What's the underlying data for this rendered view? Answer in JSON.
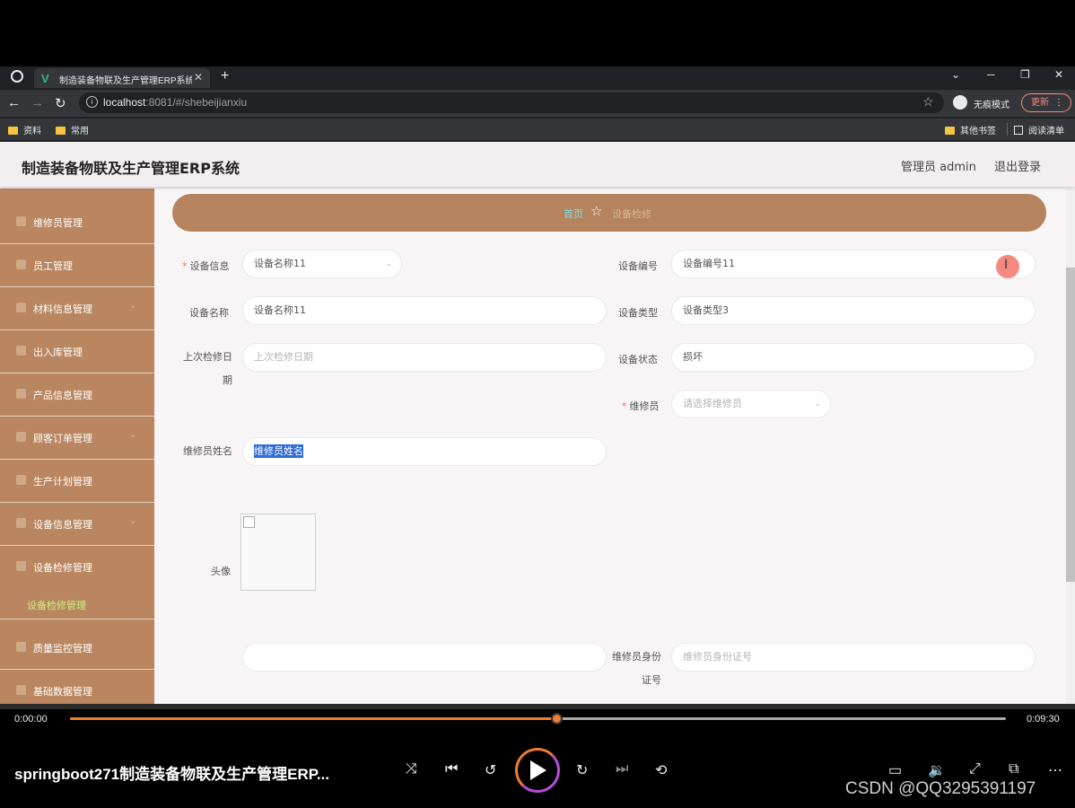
{
  "browser": {
    "tab_title": "制造装备物联及生产管理ERP系统",
    "url_host": "localhost",
    "url_path": ":8081/#/shebeijianxiu",
    "incognito_label": "无痕模式",
    "update_label": "更新",
    "bookmarks": [
      "资料",
      "常用"
    ],
    "bookmarks_right": [
      "其他书签",
      "阅读清单"
    ]
  },
  "app": {
    "title": "制造装备物联及生产管理ERP系统",
    "admin_label": "管理员 admin",
    "logout_label": "退出登录"
  },
  "sidebar": {
    "items": [
      {
        "label": "维修员管理",
        "icon": "user-icon",
        "expandable": false
      },
      {
        "label": "员工管理",
        "icon": "users-icon",
        "expandable": false
      },
      {
        "label": "材料信息管理",
        "icon": "box-icon",
        "expandable": true
      },
      {
        "label": "出入库管理",
        "icon": "warehouse-icon",
        "expandable": false
      },
      {
        "label": "产品信息管理",
        "icon": "product-icon",
        "expandable": false
      },
      {
        "label": "顾客订单管理",
        "icon": "order-icon",
        "expandable": true
      },
      {
        "label": "生产计划管理",
        "icon": "plan-icon",
        "expandable": false
      },
      {
        "label": "设备信息管理",
        "icon": "device-icon",
        "expandable": true
      },
      {
        "label": "设备检修管理",
        "icon": "repair-icon",
        "expandable": false
      }
    ],
    "sub_item": "设备检修管理",
    "items_after": [
      {
        "label": "质量监控管理",
        "icon": "quality-icon",
        "expandable": false
      },
      {
        "label": "基础数据管理",
        "icon": "data-icon",
        "expandable": false
      }
    ]
  },
  "breadcrumb": {
    "home": "首页",
    "current": "设备检修"
  },
  "form": {
    "device_info_label": "设备信息",
    "device_info_value": "设备名称11",
    "device_no_label": "设备编号",
    "device_no_value": "设备编号11",
    "device_name_label": "设备名称",
    "device_name_value": "设备名称11",
    "device_type_label": "设备类型",
    "device_type_value": "设备类型3",
    "last_check_label": "上次检修日期",
    "last_check_placeholder": "上次检修日期",
    "device_status_label": "设备状态",
    "device_status_value": "损坏",
    "repairman_label": "维修员",
    "repairman_placeholder": "请选择维修员",
    "repairman_name_label": "维修员姓名",
    "repairman_name_value": "维修员姓名",
    "avatar_label": "头像",
    "id_card_label": "维修员身份证号",
    "id_card_placeholder": "维修员身份证号"
  },
  "player": {
    "time_current": "0:00:00",
    "time_total": "0:09:30",
    "progress": 0.52,
    "video_title": "springboot271制造装备物联及生产管理ERP...",
    "watermark": "CSDN @QQ3295391197",
    "accent": "#f07c2c"
  }
}
